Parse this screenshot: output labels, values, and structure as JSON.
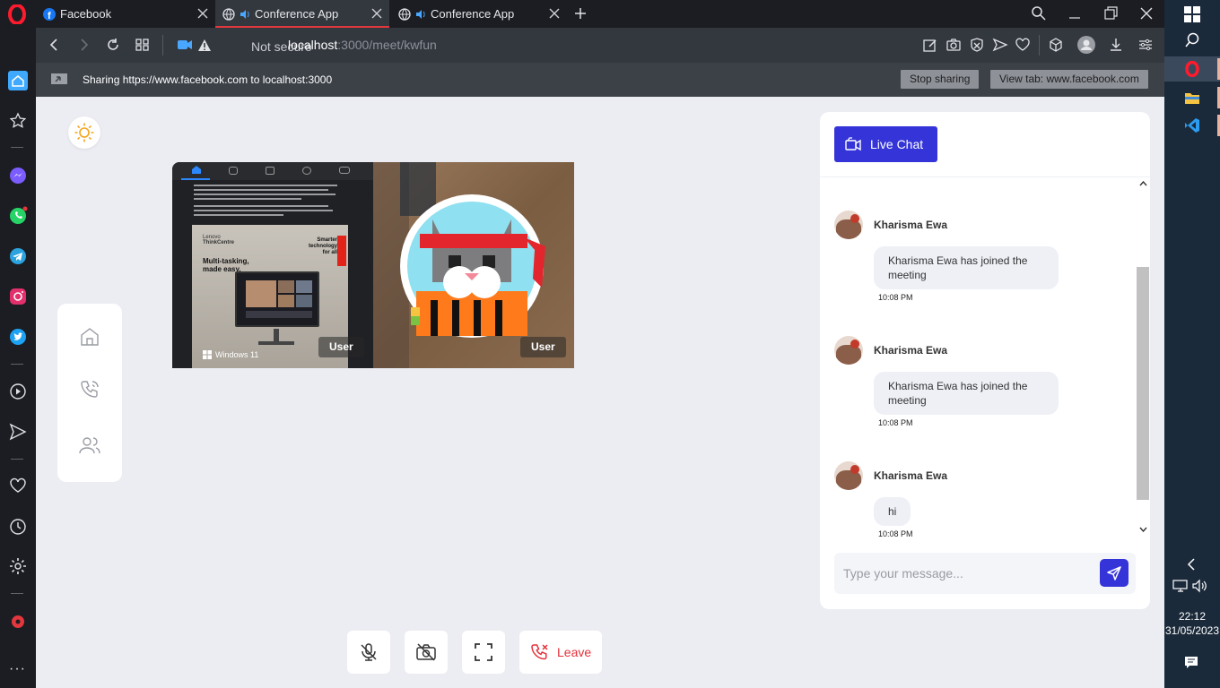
{
  "browser": {
    "tabs": [
      {
        "title": "Facebook",
        "icon": "facebook-icon"
      },
      {
        "title": "Conference App",
        "icon": "globe-icon"
      },
      {
        "title": "Conference App",
        "icon": "globe-icon"
      }
    ],
    "security_label": "Not secure",
    "url_host": "localhost",
    "url_path": ":3000/meet/kwfun",
    "share_text": "Sharing https://www.facebook.com to localhost:3000",
    "stop_sharing": "Stop sharing",
    "view_tab": "View tab: www.facebook.com"
  },
  "video": {
    "tiles": [
      {
        "label": "User",
        "type": "screen-share"
      },
      {
        "label": "User",
        "type": "avatar"
      }
    ],
    "shared_screen_texts": {
      "brand": "Lenovo",
      "product": "ThinkCentre",
      "tagline": "Smarter technology for all",
      "headline": "Multi-tasking, made easy.",
      "os": "Windows 11"
    }
  },
  "chat": {
    "title": "Live Chat",
    "messages": [
      {
        "name": "Kharisma Ewa",
        "text": "Kharisma Ewa has joined the meeting",
        "time": "10:08 PM"
      },
      {
        "name": "Kharisma Ewa",
        "text": "Kharisma Ewa has joined the meeting",
        "time": "10:08 PM"
      },
      {
        "name": "Kharisma Ewa",
        "text": "hi",
        "time": "10:08 PM"
      }
    ],
    "input_placeholder": "Type your message...",
    "input_value": ""
  },
  "controls": {
    "leave_label": "Leave"
  },
  "taskbar": {
    "time": "22:12",
    "date": "31/05/2023"
  },
  "colors": {
    "accent": "#3434d9",
    "danger": "#e5303a",
    "page_bg": "#ececf3"
  }
}
